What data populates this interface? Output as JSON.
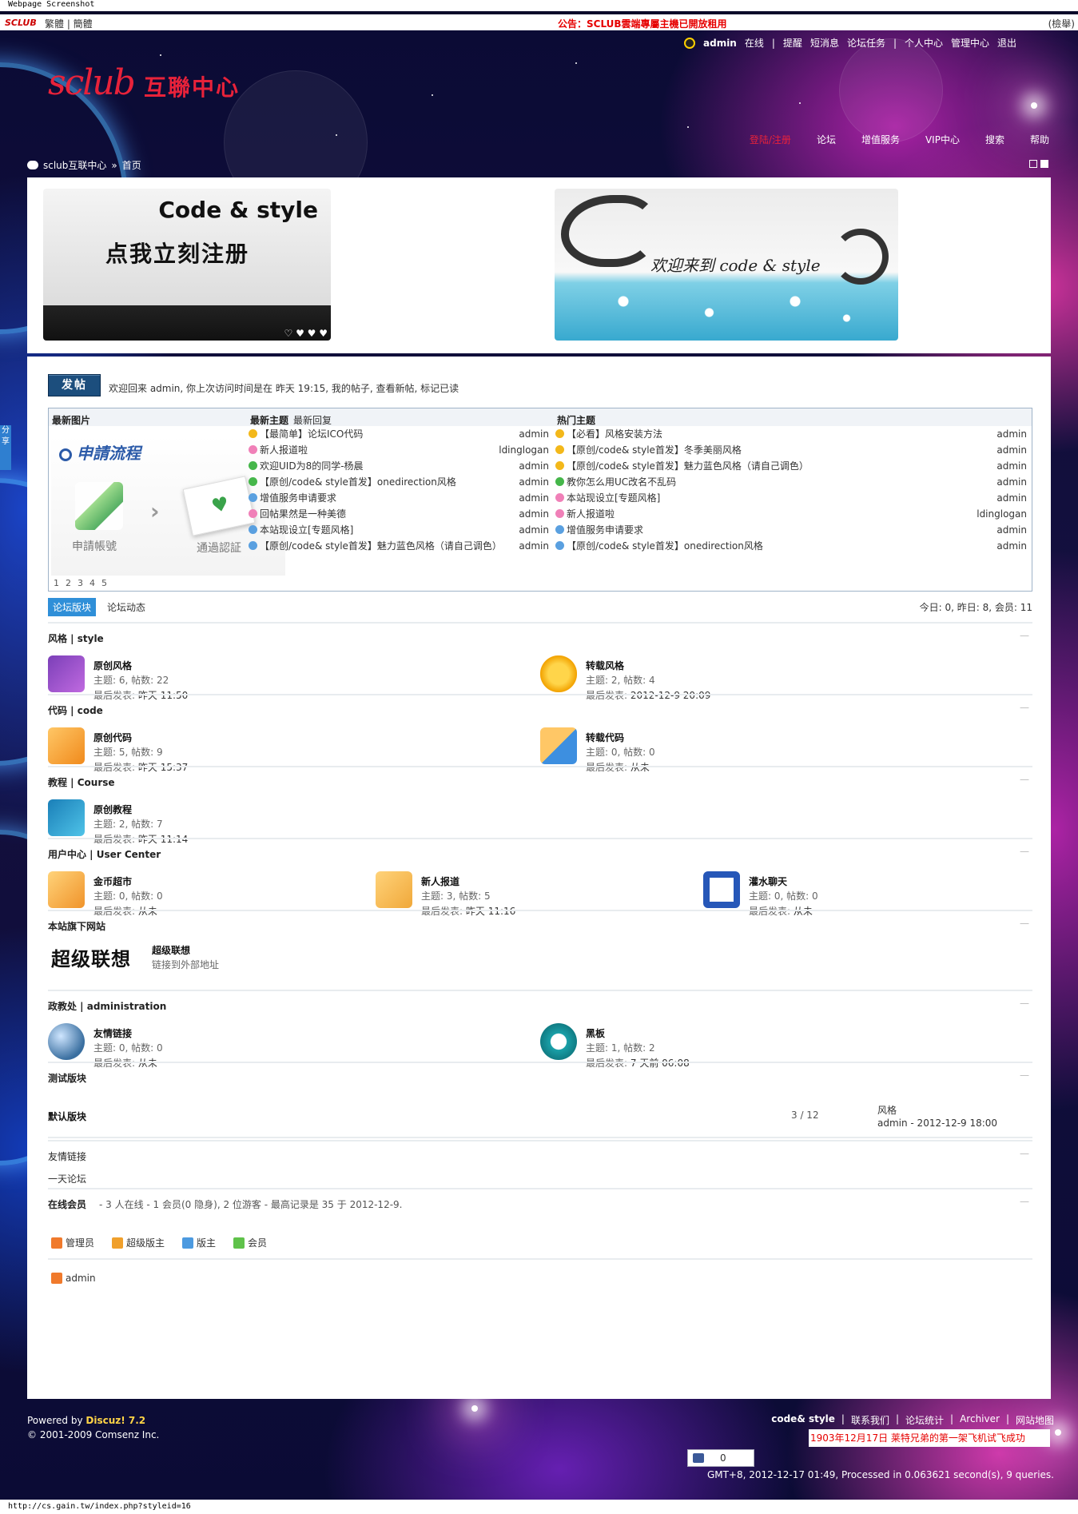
{
  "screenshot": {
    "caption": "Webpage Screenshot",
    "status_url": "http://cs.gain.tw/index.php?styleid=16"
  },
  "topbar": {
    "logo": "SCLUB",
    "lang": "繁體 | 簡體",
    "notice": "公告：SCLUB雲端專屬主機已開放租用",
    "search": "(檢舉)"
  },
  "header": {
    "logo_latin": "sclub",
    "logo_cn": "互聯中心",
    "user": {
      "name": "admin",
      "status": "在线",
      "links": [
        "提醒",
        "短消息",
        "论坛任务",
        "个人中心",
        "管理中心",
        "退出"
      ]
    },
    "nav": [
      {
        "label": "登陆/注册",
        "active": true
      },
      {
        "label": "论坛",
        "active": false
      },
      {
        "label": "增值服务",
        "active": false
      },
      {
        "label": "VIP中心",
        "active": false
      },
      {
        "label": "搜索",
        "active": false
      },
      {
        "label": "帮助",
        "active": false
      }
    ]
  },
  "breadcrumb": {
    "site": "sclub互联中心",
    "sep": "»",
    "current": "首页"
  },
  "banner": {
    "left_line1": "Code & style",
    "left_line2": "点我立刻注册",
    "dots": "♡ ♥ ♥ ♥",
    "right_text": "欢迎来到 code & style"
  },
  "welcome": {
    "post_button": "发帖",
    "text": "欢迎回来 admin, 你上次访问时间是在 昨天 19:15, 我的帖子, 查看新帖, 标记已读"
  },
  "portal": {
    "pic_title": "最新图片",
    "pic_caption": "申請流程",
    "pic_step1": "申請帳號",
    "pic_step2": "通過認証",
    "pic_pages": [
      "1",
      "2",
      "3",
      "4",
      "5"
    ],
    "latest_title": "最新主题",
    "latest_reply": "最新回复",
    "hot_title": "热门主题",
    "latest": [
      {
        "icon": "yellow",
        "title": "【最简单】论坛ICO代码",
        "author": "admin"
      },
      {
        "icon": "pink",
        "title": "新人报道啦",
        "author": "ldinglogan"
      },
      {
        "icon": "green",
        "title": "欢迎UID为8的同学-杨晨",
        "author": "admin"
      },
      {
        "icon": "green",
        "title": "【原创/code& style首发】onedirection风格",
        "author": "admin"
      },
      {
        "icon": "blue",
        "title": "增值服务申请要求",
        "author": "admin"
      },
      {
        "icon": "pink",
        "title": "回帖果然是一种美德",
        "author": "admin"
      },
      {
        "icon": "blue",
        "title": "本站现设立[专题风格]",
        "author": "admin"
      },
      {
        "icon": "blue",
        "title": "【原创/code& style首发】魅力蓝色风格（请自己调色）",
        "author": "admin"
      }
    ],
    "hot": [
      {
        "icon": "yellow",
        "title": "【必看】风格安装方法",
        "author": "admin"
      },
      {
        "icon": "yellow",
        "title": "【原创/code& style首发】冬季美丽风格",
        "author": "admin"
      },
      {
        "icon": "yellow",
        "title": "【原创/code& style首发】魅力蓝色风格（请自己调色）",
        "author": "admin"
      },
      {
        "icon": "green",
        "title": "教你怎么用UC改名不乱码",
        "author": "admin"
      },
      {
        "icon": "pink",
        "title": "本站现设立[专题风格]",
        "author": "admin"
      },
      {
        "icon": "pink",
        "title": "新人报道啦",
        "author": "ldinglogan"
      },
      {
        "icon": "blue",
        "title": "增值服务申请要求",
        "author": "admin"
      },
      {
        "icon": "blue",
        "title": "【原创/code& style首发】onedirection风格",
        "author": "admin"
      }
    ]
  },
  "tabs": {
    "active": "论坛版块",
    "other": "论坛动态",
    "stats": "今日: 0, 昨日: 8, 会员: 11"
  },
  "sections": [
    {
      "title": "风格 | style",
      "forums": [
        {
          "name": "原创风格",
          "stats": "主题: 6, 帖数: 22",
          "last_label": "最后发表:",
          "last": "昨天 11:50",
          "icon": "purple"
        },
        {
          "name": "转载风格",
          "stats": "主题: 2, 帖数: 4",
          "last_label": "最后发表:",
          "last": "2012-12-9 20:09",
          "icon": "yellow"
        }
      ]
    },
    {
      "title": "代码 | code",
      "forums": [
        {
          "name": "原创代码",
          "stats": "主题: 5, 帖数: 9",
          "last_label": "最后发表:",
          "last": "昨天 15:37",
          "icon": "orange"
        },
        {
          "name": "转载代码",
          "stats": "主题: 0, 帖数: 0",
          "last_label": "最后发表:",
          "last": "从未",
          "icon": "orange-blue"
        }
      ]
    },
    {
      "title": "教程 | Course",
      "forums": [
        {
          "name": "原创教程",
          "stats": "主题: 2, 帖数: 7",
          "last_label": "最后发表:",
          "last": "昨天 11:14",
          "icon": "teal"
        }
      ]
    },
    {
      "title": "用户中心 | User Center",
      "forums": [
        {
          "name": "金币超市",
          "stats": "主题: 0, 帖数: 0",
          "last_label": "最后发表:",
          "last": "从未",
          "icon": "folder"
        },
        {
          "name": "新人报道",
          "stats": "主题: 3, 帖数: 5",
          "last_label": "最后发表:",
          "last": "昨天 11:16",
          "icon": "folder2"
        },
        {
          "name": "灌水聊天",
          "stats": "主题: 0, 帖数: 0",
          "last_label": "最后发表:",
          "last": "从未",
          "icon": "blue-square"
        }
      ]
    },
    {
      "title": "本站旗下网站",
      "partner": {
        "logo_text": "超级联想",
        "name": "超级联想",
        "desc": "链接到外部地址"
      }
    },
    {
      "title": "政教处 | administration",
      "forums": [
        {
          "name": "友情链接",
          "stats": "主题: 0, 帖数: 0",
          "last_label": "最后发表:",
          "last": "从未",
          "icon": "globe"
        },
        {
          "name": "黑板",
          "stats": "主题: 1, 帖数: 2",
          "last_label": "最后发表:",
          "last": "7 天前 06:08",
          "icon": "clock"
        }
      ]
    },
    {
      "title": "测试版块"
    }
  ],
  "default_forum": {
    "name": "默认版块",
    "count": "3 / 12",
    "last_title": "风格",
    "last_meta": "admin - 2012-12-9 18:00"
  },
  "links_section": {
    "title": "友情链接",
    "item": "一天论坛"
  },
  "online": {
    "title": "在线会员",
    "summary": "- 3 人在线 - 1 会员(0 隐身), 2 位游客 - 最高记录是 35 于 2012-12-9.",
    "legend": [
      {
        "label": "管理员",
        "color": "#f07a2c"
      },
      {
        "label": "超级版主",
        "color": "#f0a02c"
      },
      {
        "label": "版主",
        "color": "#4c9ae0"
      },
      {
        "label": "会员",
        "color": "#5fc24a"
      }
    ],
    "users": [
      "admin"
    ]
  },
  "side_share": "分享",
  "footer": {
    "powered_prefix": "Powered by",
    "powered_brand": "Discuz! 7.2",
    "copyright": "© 2001-2009 Comsenz Inc.",
    "links": [
      "code& style",
      "联系我们",
      "论坛统计",
      "Archiver",
      "网站地图"
    ],
    "ticker": "1903年12月17日 莱特兄弟的第一架飞机试飞成功",
    "like_count": "0",
    "gmt": "GMT+8, 2012-12-17 01:49, Processed in 0.063621 second(s), 9 queries."
  },
  "colors": {
    "accent_red": "#e8223a",
    "post_button": "#1c4e7d",
    "tab_active": "#2f8fd8",
    "notice_red": "#e60000"
  }
}
